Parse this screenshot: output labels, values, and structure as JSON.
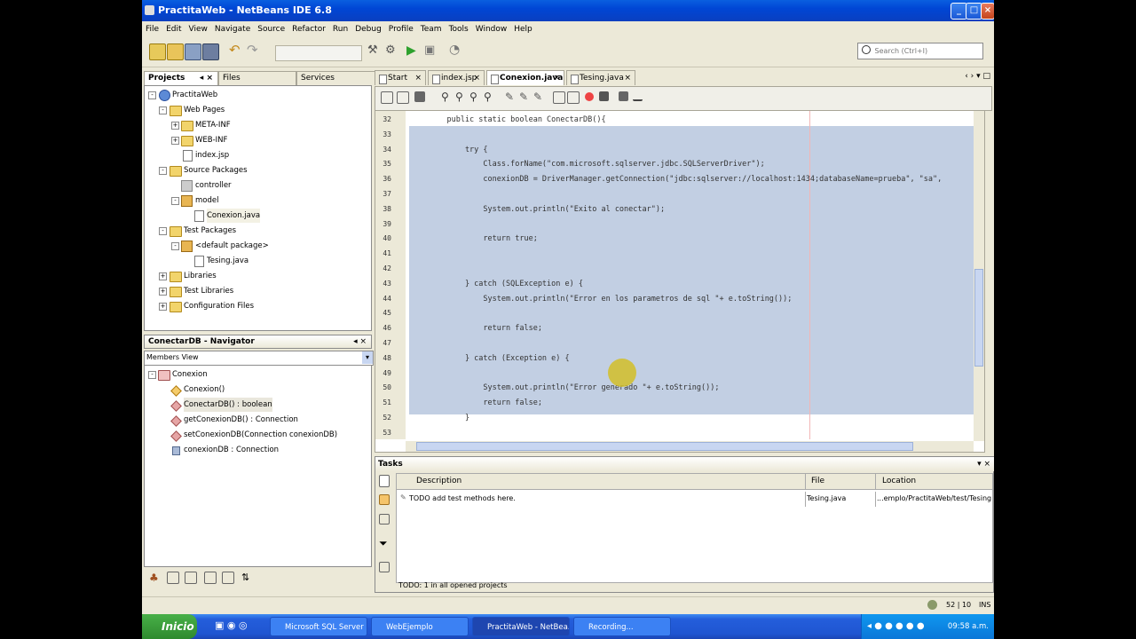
{
  "window": {
    "title": "PractitaWeb - NetBeans IDE 6.8"
  },
  "menu": [
    "File",
    "Edit",
    "View",
    "Navigate",
    "Source",
    "Refactor",
    "Run",
    "Debug",
    "Profile",
    "Team",
    "Tools",
    "Window",
    "Help"
  ],
  "search": {
    "placeholder": "Search (Ctrl+I)"
  },
  "projects_panel": {
    "tabs": [
      "Projects",
      "Files",
      "Services"
    ],
    "tree": [
      {
        "label": "PractitaWeb",
        "level": 0,
        "icon": "globe-icon"
      },
      {
        "label": "Web Pages",
        "level": 1,
        "icon": "folder-icon"
      },
      {
        "label": "META-INF",
        "level": 2,
        "icon": "folder-icon"
      },
      {
        "label": "WEB-INF",
        "level": 2,
        "icon": "folder-icon"
      },
      {
        "label": "index.jsp",
        "level": 2,
        "icon": "file-icon"
      },
      {
        "label": "Source Packages",
        "level": 1,
        "icon": "folder-icon"
      },
      {
        "label": "controller",
        "level": 2,
        "icon": "package-icon"
      },
      {
        "label": "model",
        "level": 2,
        "icon": "package-icon"
      },
      {
        "label": "Conexion.java",
        "level": 3,
        "icon": "java-file-icon"
      },
      {
        "label": "Test Packages",
        "level": 1,
        "icon": "folder-icon"
      },
      {
        "label": "<default package>",
        "level": 2,
        "icon": "package-icon"
      },
      {
        "label": "Tesing.java",
        "level": 3,
        "icon": "java-file-icon"
      },
      {
        "label": "Libraries",
        "level": 1,
        "icon": "folder-icon"
      },
      {
        "label": "Test Libraries",
        "level": 1,
        "icon": "folder-icon"
      },
      {
        "label": "Configuration Files",
        "level": 1,
        "icon": "folder-icon"
      }
    ]
  },
  "navigator": {
    "title": "ConectarDB - Navigator",
    "view": "Members View",
    "root": "Conexion",
    "members": [
      {
        "label": "Conexion()",
        "kind": "constructor"
      },
      {
        "label": "ConectarDB() : boolean",
        "kind": "method"
      },
      {
        "label": "getConexionDB() : Connection",
        "kind": "method"
      },
      {
        "label": "setConexionDB(Connection conexionDB)",
        "kind": "method"
      },
      {
        "label": "conexionDB : Connection",
        "kind": "field"
      }
    ]
  },
  "editor": {
    "tabs": [
      "Start Page",
      "index.jsp",
      "Conexion.java",
      "Tesing.java"
    ],
    "active_tab": "Conexion.java",
    "lines": [
      {
        "n": "32",
        "code": "    public static boolean ConectarDB(){"
      },
      {
        "n": "33",
        "code": ""
      },
      {
        "n": "34",
        "code": "        try {"
      },
      {
        "n": "35",
        "code": "            Class.forName(\"com.microsoft.sqlserver.jdbc.SQLServerDriver\");"
      },
      {
        "n": "36",
        "code": "            conexionDB = DriverManager.getConnection(\"jdbc:sqlserver://localhost:1434;databaseName=prueba\", \"sa\","
      },
      {
        "n": "37",
        "code": ""
      },
      {
        "n": "38",
        "code": "            System.out.println(\"Exito al conectar\");"
      },
      {
        "n": "39",
        "code": ""
      },
      {
        "n": "40",
        "code": "            return true;"
      },
      {
        "n": "41",
        "code": ""
      },
      {
        "n": "42",
        "code": ""
      },
      {
        "n": "43",
        "code": "        } catch (SQLException e) {"
      },
      {
        "n": "44",
        "code": "            System.out.println(\"Error en los parametros de sql \"+ e.toString());"
      },
      {
        "n": "45",
        "code": ""
      },
      {
        "n": "46",
        "code": "            return false;"
      },
      {
        "n": "47",
        "code": ""
      },
      {
        "n": "48",
        "code": "        } catch (Exception e) {"
      },
      {
        "n": "49",
        "code": ""
      },
      {
        "n": "50",
        "code": "            System.out.println(\"Error generado \"+ e.toString());"
      },
      {
        "n": "51",
        "code": "            return false;"
      },
      {
        "n": "52",
        "code": "        }"
      },
      {
        "n": "53",
        "code": ""
      }
    ]
  },
  "tasks": {
    "title": "Tasks",
    "columns": [
      "Description",
      "File",
      "Location"
    ],
    "rows": [
      {
        "description": "TODO add test methods here.",
        "file": "Tesing.java",
        "location": "...emplo/PractitaWeb/test/Tesing.java"
      }
    ],
    "footer": "TODO: 1 in all opened projects"
  },
  "status_bar": {
    "position": "52 | 10",
    "mode": "INS"
  },
  "taskbar": {
    "start_label": "Inicio",
    "buttons": [
      "Microsoft SQL Server ...",
      "WebEjemplo",
      "PractitaWeb - NetBea...",
      "Recording..."
    ],
    "active_button": "PractitaWeb - NetBea...",
    "clock": "09:58 a.m."
  }
}
